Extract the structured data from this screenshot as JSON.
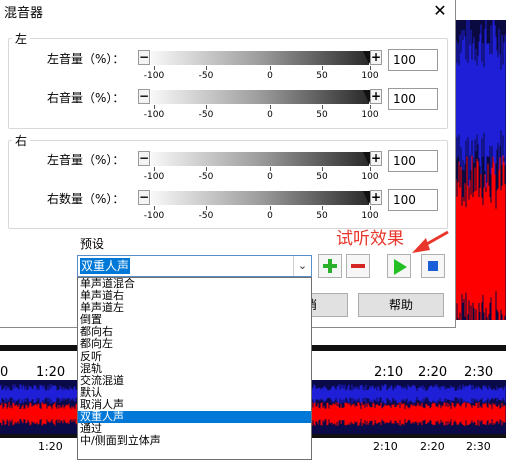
{
  "dialog": {
    "title": "混音器",
    "close_glyph": "✕"
  },
  "left_group": {
    "legend": "左",
    "rows": [
      {
        "label": "左音量（%）：",
        "value": "100",
        "level": 100
      },
      {
        "label": "右音量（%）：",
        "value": "100",
        "level": 100
      }
    ]
  },
  "right_group": {
    "legend": "右",
    "rows": [
      {
        "label": "左音量（%）：",
        "value": "100",
        "level": 100
      },
      {
        "label": "右数量（%）：",
        "value": "100",
        "level": 100
      }
    ]
  },
  "scale_labels": [
    "-100",
    "-50",
    "0",
    "50",
    "100"
  ],
  "slider_buttons": {
    "minus": "−",
    "plus": "+"
  },
  "preset": {
    "label": "预设",
    "selected": "双重人声",
    "options": [
      "单声道混合",
      "单声道右",
      "单声道左",
      "倒置",
      "都向右",
      "都向左",
      "反听",
      "混轨",
      "交流混道",
      "默认",
      "取消人声",
      "双重人声",
      "通过",
      "中/侧面到立体声"
    ],
    "selected_index": 11
  },
  "buttons": {
    "cancel_partial": "消",
    "help": "帮助"
  },
  "annotation": {
    "text": "试听效果",
    "color": "#e8362a"
  },
  "timeline": {
    "ruler_top": [
      "0",
      "1:20",
      "2:10",
      "2:20",
      "2:30"
    ],
    "ruler_bottom": [
      "1:20",
      "2:10",
      "2:20",
      "2:30"
    ]
  },
  "colors": {
    "selection": "#0078d7",
    "waveform_red": "#ff0000",
    "waveform_blue": "#1f1fd8",
    "waveform_bg": "#0c0c4a",
    "add_green": "#2bb02b",
    "remove_red": "#d42424",
    "play_green": "#22c022",
    "stop_blue": "#1a5fd8"
  },
  "icons": {
    "add": "plus-icon",
    "remove": "minus-icon",
    "play": "play-icon",
    "stop": "stop-icon",
    "dropdown": "chevron-down-icon"
  }
}
